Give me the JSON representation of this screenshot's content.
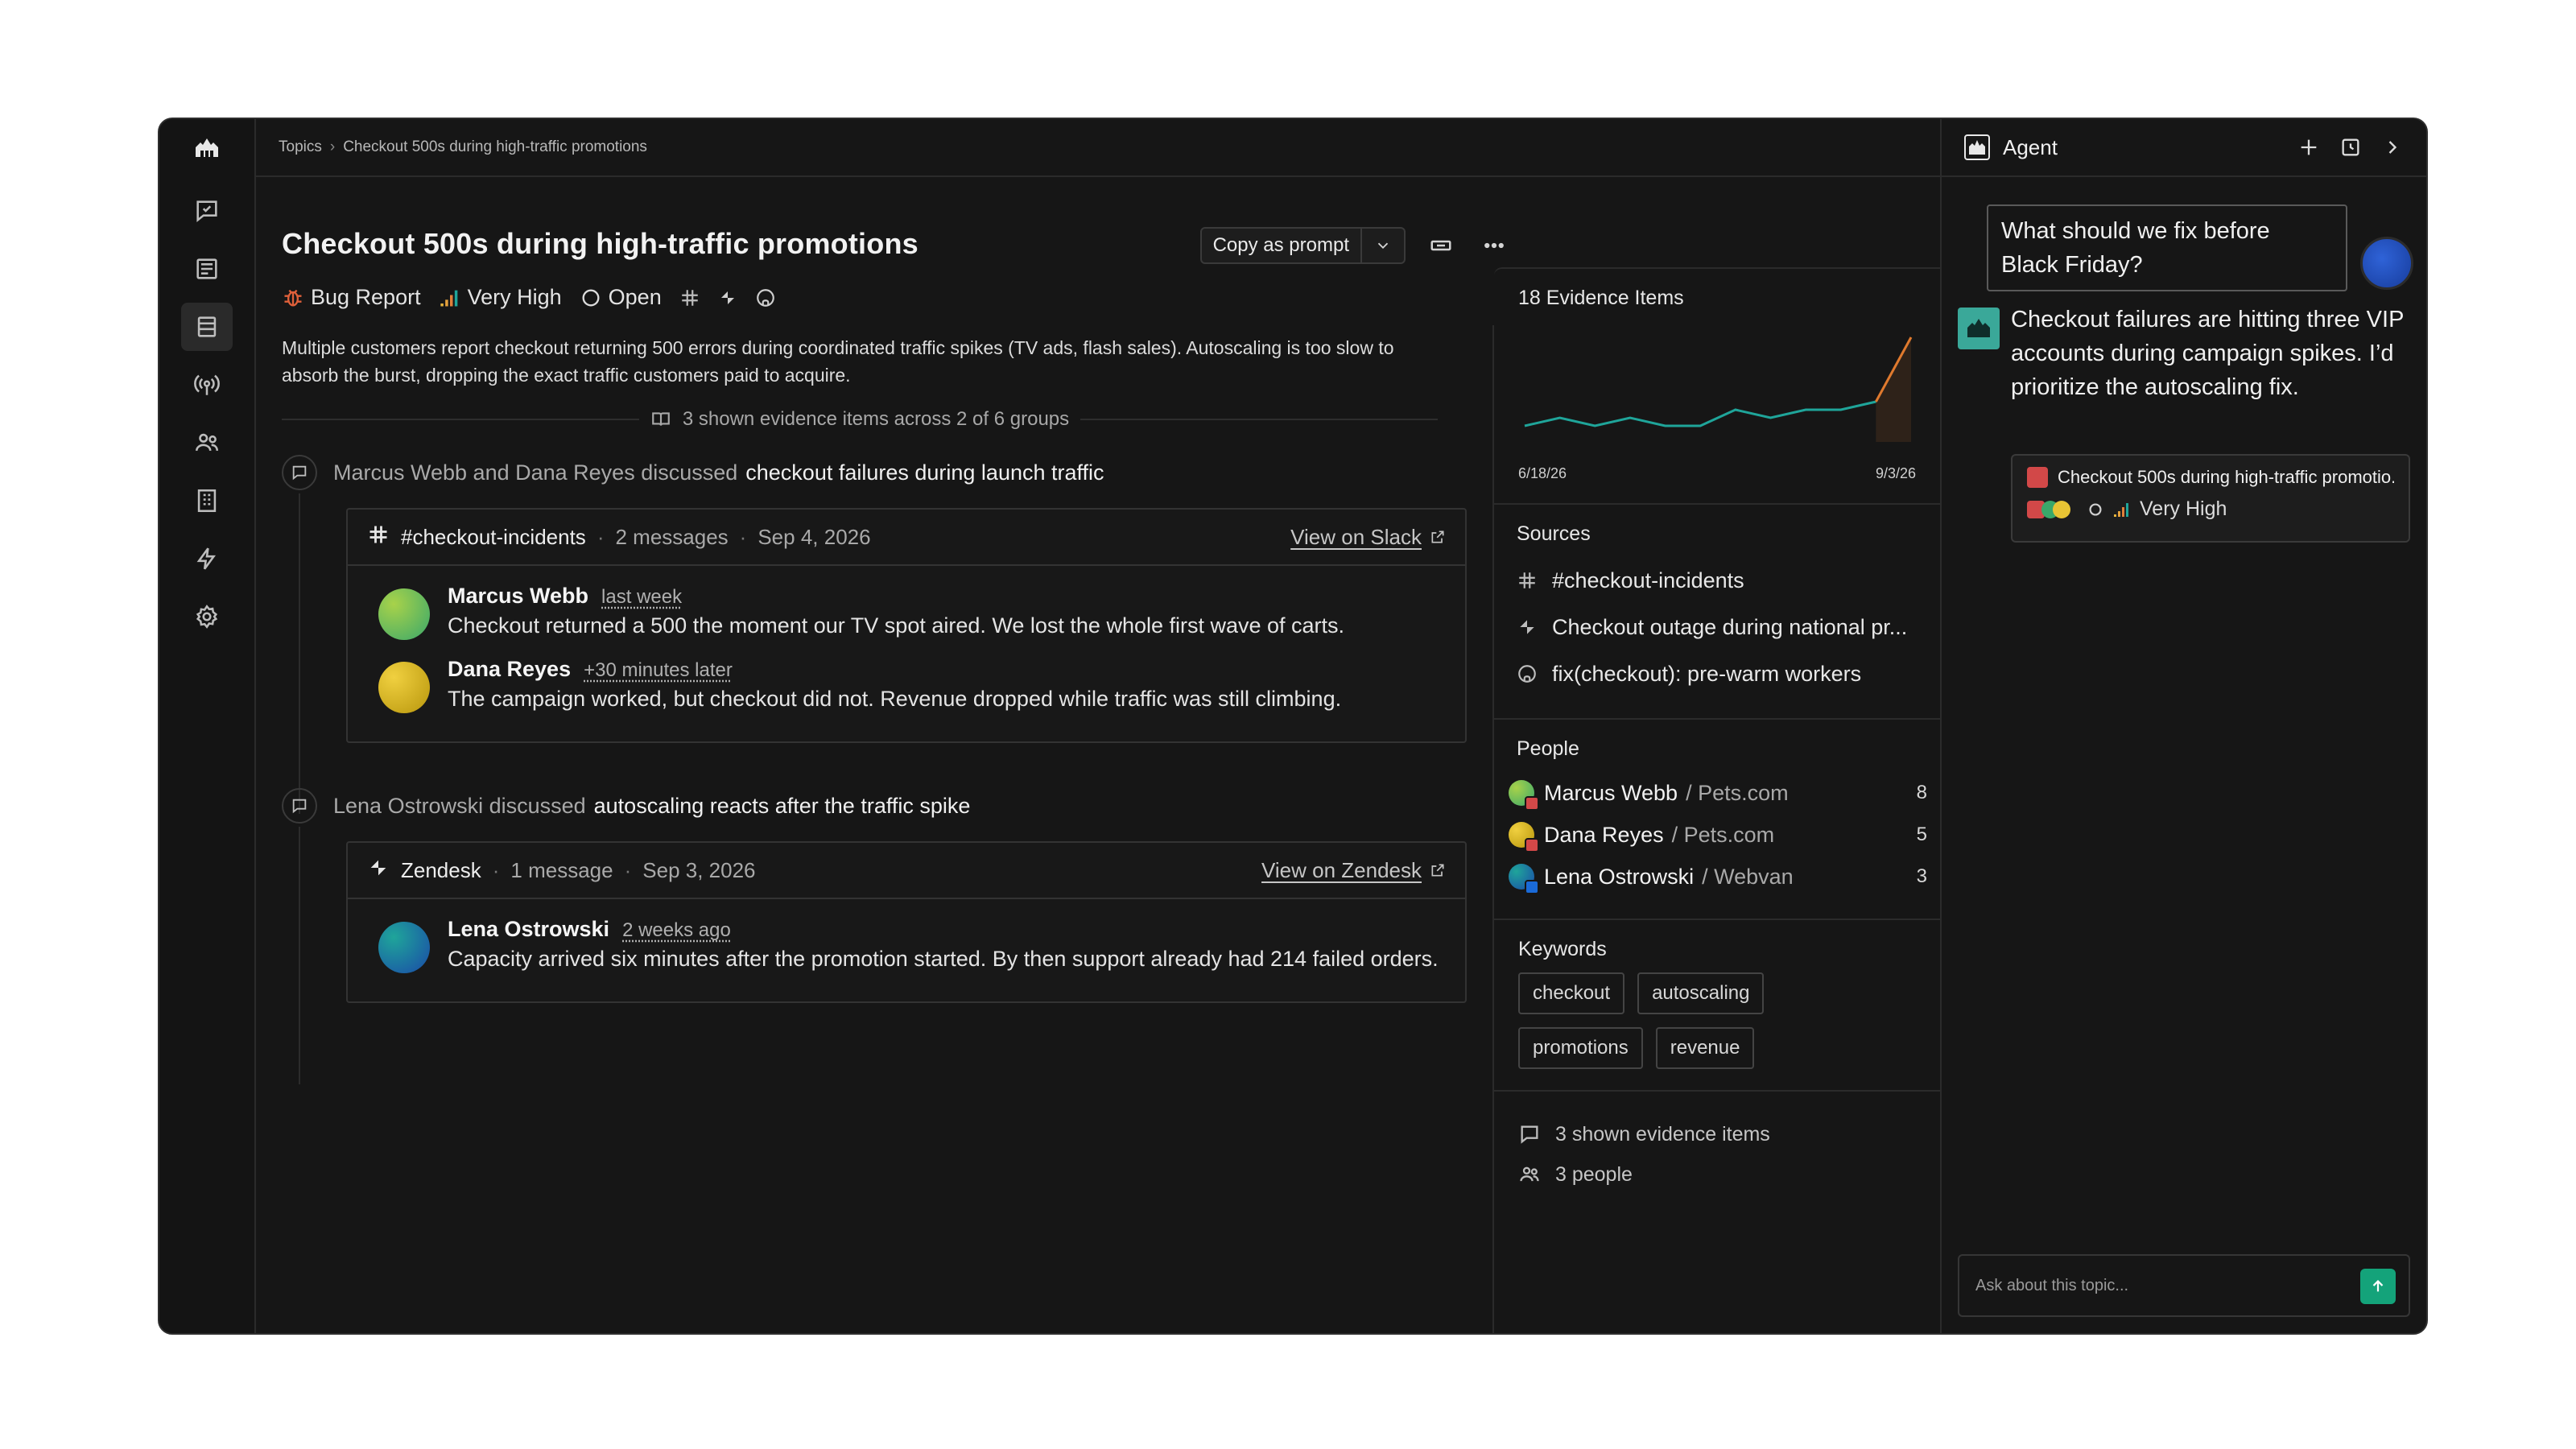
{
  "breadcrumb": {
    "root": "Topics",
    "current": "Checkout 500s during high-traffic promotions"
  },
  "topic": {
    "title": "Checkout 500s during high-traffic promotions",
    "type": "Bug Report",
    "priority": "Very High",
    "status": "Open",
    "description": "Multiple customers report checkout returning 500 errors during coordinated traffic spikes (TV ads, flash sales). Autoscaling is too slow to absorb the burst, dropping the exact traffic customers paid to acquire."
  },
  "actions": {
    "copy_label": "Copy as prompt"
  },
  "evidence_summary": "3 shown evidence items across 2 of 6 groups",
  "groups": [
    {
      "lead": "Marcus Webb and Dana Reyes discussed",
      "topic": "checkout failures during launch traffic",
      "source": "#checkout-incidents",
      "count": "2 messages",
      "date": "Sep 4, 2026",
      "view": "View on Slack",
      "messages": [
        {
          "name": "Marcus Webb",
          "when": "last week",
          "text": "Checkout returned a 500 the moment our TV spot aired. We lost the whole first wave of carts."
        },
        {
          "name": "Dana Reyes",
          "when": "+30 minutes later",
          "text": "The campaign worked, but checkout did not. Revenue dropped while traffic was still climbing."
        }
      ]
    },
    {
      "lead": "Lena Ostrowski discussed",
      "topic": "autoscaling reacts after the traffic spike",
      "source": "Zendesk",
      "count": "1 message",
      "date": "Sep 3, 2026",
      "view": "View on Zendesk",
      "messages": [
        {
          "name": "Lena Ostrowski",
          "when": "2 weeks ago",
          "text": "Capacity arrived six minutes after the promotion started. By then support already had 214 failed orders."
        }
      ]
    }
  ],
  "panel": {
    "evidence_title": "18 Evidence Items",
    "chart_start": "6/18/26",
    "chart_end": "9/3/26",
    "chart_values": [
      1,
      2,
      1,
      2,
      1,
      1,
      3,
      2,
      3,
      3,
      4,
      12
    ],
    "sources_title": "Sources",
    "sources": [
      {
        "icon": "slack-icon",
        "label": "#checkout-incidents"
      },
      {
        "icon": "zendesk-icon",
        "label": "Checkout outage during national pr..."
      },
      {
        "icon": "github-icon",
        "label": "fix(checkout): pre-warm workers"
      }
    ],
    "people_title": "People",
    "people": [
      {
        "name": "Marcus Webb",
        "org": "/ Pets.com",
        "count": "8"
      },
      {
        "name": "Dana Reyes",
        "org": "/ Pets.com",
        "count": "5"
      },
      {
        "name": "Lena Ostrowski",
        "org": "/ Webvan",
        "count": "3"
      }
    ],
    "keywords_title": "Keywords",
    "keywords": [
      "checkout",
      "autoscaling",
      "promotions",
      "revenue"
    ],
    "footer_items": "3 shown evidence items",
    "footer_people": "3 people"
  },
  "agent": {
    "title": "Agent",
    "user_message": "What should we fix before Black Friday?",
    "reply": "Checkout failures are hitting three VIP accounts during campaign spikes. I’d prioritize the autoscaling fix.",
    "card_title": "Checkout 500s during high-traffic promotio...",
    "card_priority": "Very High",
    "input_placeholder": "Ask about this topic..."
  },
  "colors": {
    "accent_green": "#14a37a",
    "chart_line": "#1fa59a",
    "chart_spike": "#e07a2e",
    "bug_red": "#d24848"
  }
}
